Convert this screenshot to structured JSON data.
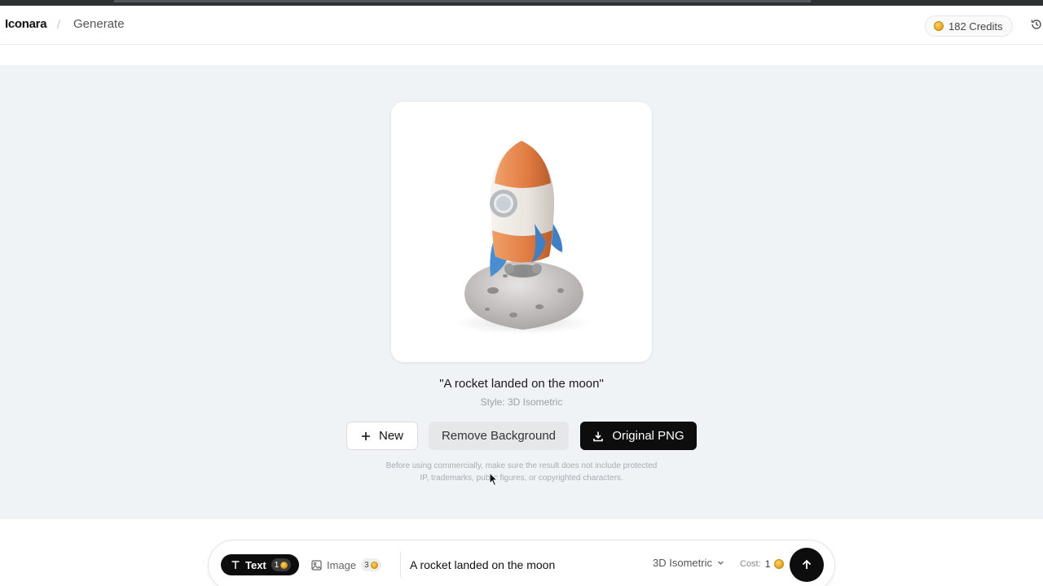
{
  "header": {
    "brand": "Iconara",
    "separator": "/",
    "breadcrumb": "Generate",
    "credits_label": "182 Credits"
  },
  "result": {
    "prompt_quoted": "\"A rocket landed on the moon\"",
    "style_line": "Style: 3D Isometric"
  },
  "actions": {
    "new_label": "New",
    "remove_bg_label": "Remove Background",
    "download_label": "Original PNG"
  },
  "disclaimer": "Before using commercially, make sure the result does not include protected IP, trademarks, public figures, or copyrighted characters.",
  "composer": {
    "text_tab_label": "Text",
    "text_tab_cost": "1",
    "image_tab_label": "Image",
    "image_tab_cost": "3",
    "prompt_value": "A rocket landed on the moon",
    "style_value": "3D Isometric",
    "cost_label": "Cost:",
    "cost_value": "1"
  },
  "icons": {
    "history": "history-icon",
    "plus": "plus-icon",
    "download": "download-icon",
    "send": "arrow-up-icon"
  },
  "colors": {
    "accent_dark": "#0d0d0d",
    "canvas_bg": "#eff3f6",
    "coin": "#e2a21a"
  }
}
